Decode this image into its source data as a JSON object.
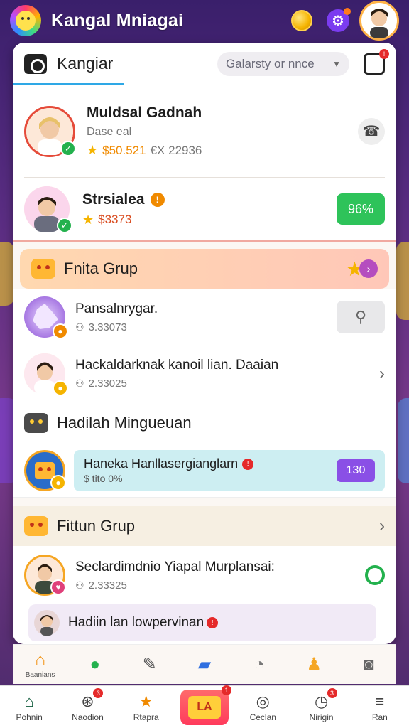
{
  "app": {
    "title": "Kangal Mniagai"
  },
  "panel": {
    "title": "Kangiar",
    "search_placeholder": "Galarsty or nnce"
  },
  "contacts": [
    {
      "name": "Muldsal Gadnah",
      "sub": "Dase eal",
      "stat_main": "$50.521",
      "stat_sub": "€X 22936"
    },
    {
      "name": "Strsialea",
      "stat_main": "$3373",
      "percent": "96%"
    }
  ],
  "section1": {
    "title": "Fnita Grup",
    "items": [
      {
        "title": "Pansalnrygar.",
        "stat": "3.33073"
      },
      {
        "title": "Hackaldarknak kanoil lian. Daaian",
        "stat": "2.33025"
      }
    ]
  },
  "section2": {
    "title": "Hadilah Mingueuan",
    "reward_title": "Haneka Hanllasergianglarn",
    "reward_sub": "$ tito 0%",
    "reward_value": "130"
  },
  "section3": {
    "title": "Fittun Grup",
    "item_title": "Seclardimdnio Yiapal Murplansai:",
    "item_stat": "2.33325",
    "banner": "Hadiin lan lowpervinan"
  },
  "tab_strip": {
    "first_label": "Baanians"
  },
  "nav": [
    {
      "label": "Pohnin",
      "icon": "home-icon"
    },
    {
      "label": "Naodion",
      "icon": "rescue-icon",
      "badge": "3"
    },
    {
      "label": "Rtapra",
      "icon": "star-icon"
    },
    {
      "label": "LA",
      "icon": "center-game-icon",
      "badge": "1"
    },
    {
      "label": "Ceclan",
      "icon": "chat-icon"
    },
    {
      "label": "Nirigin",
      "icon": "clock-icon",
      "badge": "3"
    },
    {
      "label": "Ran",
      "icon": "menu-icon"
    }
  ],
  "colors": {
    "accent": "#2ea8e6",
    "green": "#23b14d",
    "purple": "#7b3cf0",
    "badge_red": "#e52a2a"
  }
}
